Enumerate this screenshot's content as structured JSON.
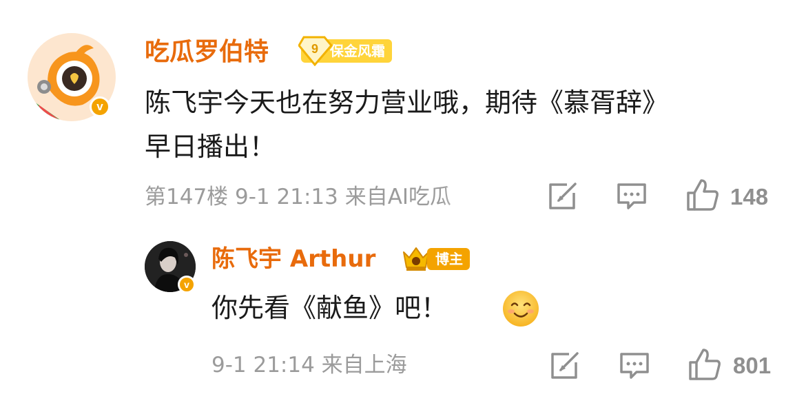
{
  "comment": {
    "username": "吃瓜罗伯特",
    "fan_badge_level": "9",
    "fan_badge_label": "保金风霜",
    "verified_mark": "v",
    "text_line1": "陈飞宇今天也在努力营业哦，期待《慕胥辞》",
    "text_line2": "早日播出！",
    "meta": "第147楼 9-1 21:13 来自AI吃瓜",
    "like_count": "148",
    "icons": [
      "repost-icon",
      "comment-icon",
      "like-icon"
    ]
  },
  "reply": {
    "username": "陈飞宇 Arthur",
    "host_badge_label": "博主",
    "verified_mark": "v",
    "text": "你先看《献鱼》吧！",
    "emoji": "smile",
    "meta": "9-1 21:14 来自上海",
    "like_count": "801",
    "icons": [
      "repost-icon",
      "comment-icon",
      "like-icon"
    ]
  },
  "colors": {
    "username": "#e86b0c",
    "badge_yellow": "#ffd43a",
    "host_badge": "#f4a300",
    "meta_gray": "#9b9b9b"
  }
}
